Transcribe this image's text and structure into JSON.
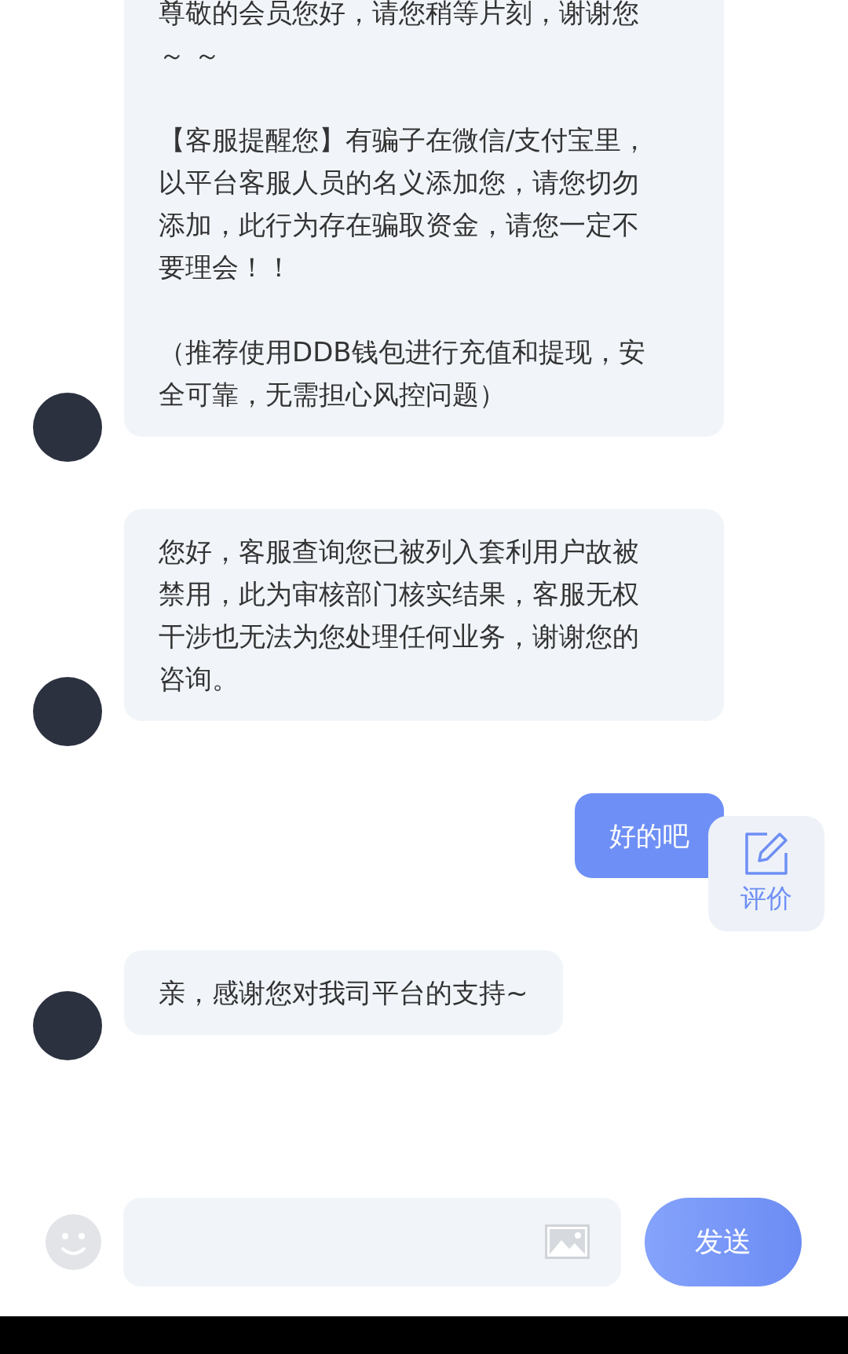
{
  "messages": [
    {
      "kind": "agent",
      "paragraphs": [
        "尊敬的会员您好，请您稍等片刻，谢谢您～ ～",
        "【客服提醒您】有骗子在微信/支付宝里，以平台客服人员的名义添加您，请您切勿添加，此行为存在骗取资金，请您一定不要理会！！",
        "（推荐使用DDB钱包进行充值和提现，安全可靠，无需担心风控问题）"
      ]
    },
    {
      "kind": "agent",
      "paragraphs": [
        "您好，客服查询您已被列入套利用户故被禁用，此为审核部门核实结果，客服无权干涉也无法为您处理任何业务，谢谢您的咨询。"
      ]
    },
    {
      "kind": "user",
      "paragraphs": [
        "好的吧"
      ]
    },
    {
      "kind": "agent",
      "paragraphs": [
        "亲，感谢您对我司平台的支持~"
      ]
    }
  ],
  "rate_button": {
    "label": "评价"
  },
  "composer": {
    "send_label": "发送"
  }
}
